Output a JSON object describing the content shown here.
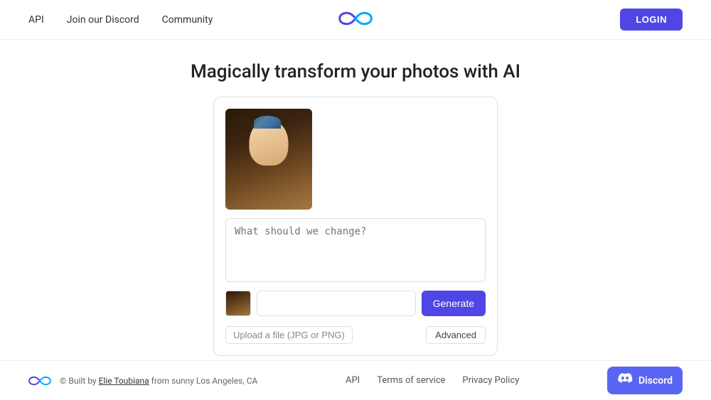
{
  "navbar": {
    "api_label": "API",
    "discord_label": "Join our Discord",
    "community_label": "Community",
    "login_label": "LOGIN"
  },
  "hero": {
    "headline": "Magically transform your photos with AI"
  },
  "prompt": {
    "placeholder": "What should we change?",
    "input_placeholder": ""
  },
  "buttons": {
    "generate_label": "Generate",
    "upload_label": "Upload a file",
    "upload_hint": "(JPG or PNG)",
    "advanced_label": "Advanced"
  },
  "footer": {
    "copyright": "© Built by ",
    "author": "Elie Toubiana",
    "location": " from sunny Los Angeles, CA",
    "api_label": "API",
    "terms_label": "Terms of service",
    "privacy_label": "Privacy Policy",
    "discord_label": "Discord"
  }
}
